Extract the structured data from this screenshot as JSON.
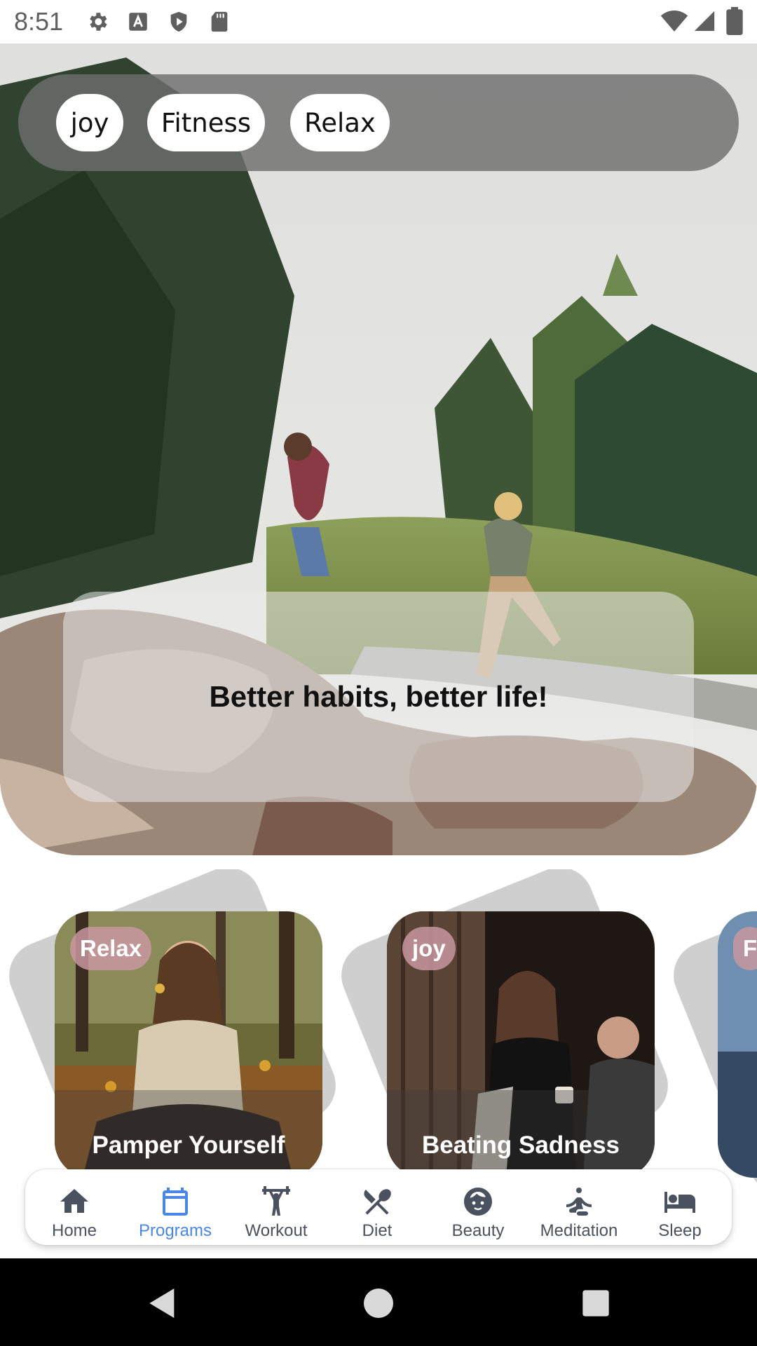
{
  "status_bar": {
    "time": "8:51",
    "icons": [
      "gear-icon",
      "font-a-icon",
      "play-shield-icon",
      "sd-card-icon"
    ],
    "right_icons": [
      "wifi-icon",
      "signal-icon",
      "battery-icon"
    ]
  },
  "hero": {
    "chips": [
      {
        "label": "joy"
      },
      {
        "label": "Fitness"
      },
      {
        "label": "Relax"
      }
    ],
    "tagline": "Better habits, better life!"
  },
  "programs": [
    {
      "badge": "Relax",
      "title": "Pamper Yourself"
    },
    {
      "badge": "joy",
      "title": "Beating Sadness"
    },
    {
      "badge": "F",
      "title": ""
    }
  ],
  "bottom_nav": {
    "active": "Programs",
    "items": [
      {
        "label": "Home",
        "icon": "home-icon"
      },
      {
        "label": "Programs",
        "icon": "calendar-icon"
      },
      {
        "label": "Workout",
        "icon": "weightlifter-icon"
      },
      {
        "label": "Diet",
        "icon": "utensils-icon"
      },
      {
        "label": "Beauty",
        "icon": "face-icon"
      },
      {
        "label": "Meditation",
        "icon": "meditation-icon"
      },
      {
        "label": "Sleep",
        "icon": "bed-icon"
      }
    ]
  },
  "colors": {
    "accent": "#4a86e8",
    "nav_inactive": "#4a5260",
    "badge": "#c896a0",
    "chip_bar": "#6e6e6e"
  }
}
